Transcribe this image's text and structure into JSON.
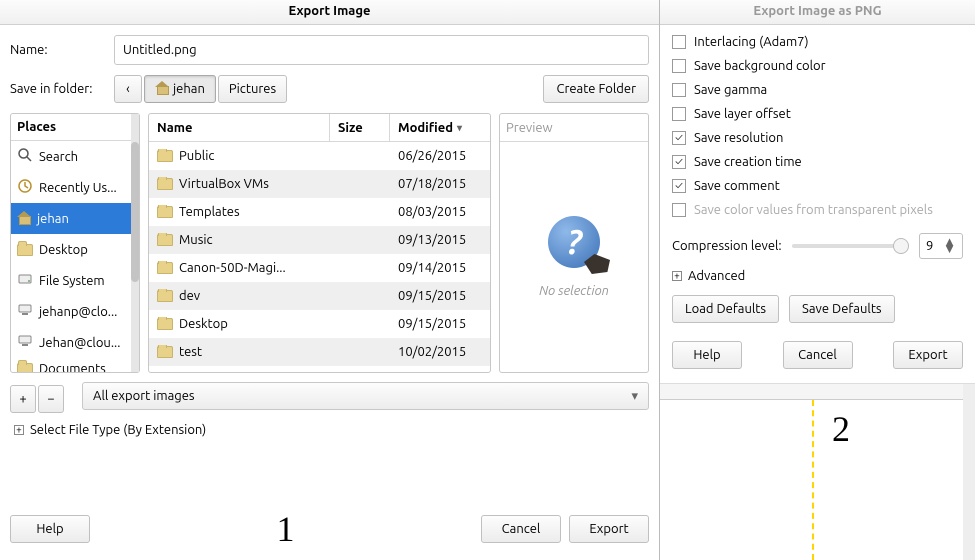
{
  "left": {
    "title": "Export Image",
    "name_label": "Name:",
    "name_value": "Untitled.png",
    "save_in_label": "Save in folder:",
    "breadcrumb": {
      "back": "‹",
      "seg1": "jehan",
      "seg2": "Pictures"
    },
    "create_folder": "Create Folder",
    "places_header": "Places",
    "places": [
      {
        "label": "Search",
        "icon": "search"
      },
      {
        "label": "Recently Us...",
        "icon": "recent"
      },
      {
        "label": "jehan",
        "icon": "home",
        "selected": true
      },
      {
        "label": "Desktop",
        "icon": "folder"
      },
      {
        "label": "File System",
        "icon": "disk"
      },
      {
        "label": "jehanp@clo...",
        "icon": "net"
      },
      {
        "label": "Jehan@clou...",
        "icon": "net"
      },
      {
        "label": "Documents",
        "icon": "folder",
        "cut": true
      }
    ],
    "files_header": {
      "name": "Name",
      "size": "Size",
      "modified": "Modified"
    },
    "files": [
      {
        "name": "Public",
        "modified": "06/26/2015"
      },
      {
        "name": "VirtualBox VMs",
        "modified": "07/18/2015"
      },
      {
        "name": "Templates",
        "modified": "08/03/2015"
      },
      {
        "name": "Music",
        "modified": "09/13/2015"
      },
      {
        "name": "Canon-50D-Magi...",
        "modified": "09/14/2015"
      },
      {
        "name": "dev",
        "modified": "09/15/2015"
      },
      {
        "name": "Desktop",
        "modified": "09/15/2015"
      },
      {
        "name": "test",
        "modified": "10/02/2015"
      }
    ],
    "preview_label": "Preview",
    "no_selection": "No selection",
    "add_btn": "+",
    "remove_btn": "−",
    "filter": "All export images",
    "filetype_expander": "Select File Type (By Extension)",
    "help": "Help",
    "cancel": "Cancel",
    "export": "Export",
    "big_num": "1"
  },
  "right": {
    "title": "Export Image as PNG",
    "options": [
      {
        "label": "Interlacing (Adam7)",
        "checked": false
      },
      {
        "label": "Save background color",
        "checked": false
      },
      {
        "label": "Save gamma",
        "checked": false
      },
      {
        "label": "Save layer offset",
        "checked": false
      },
      {
        "label": "Save resolution",
        "checked": true
      },
      {
        "label": "Save creation time",
        "checked": true
      },
      {
        "label": "Save comment",
        "checked": true
      },
      {
        "label": "Save color values from transparent pixels",
        "checked": false,
        "disabled": true
      }
    ],
    "compression_label": "Compression level:",
    "compression_value": "9",
    "advanced": "Advanced",
    "load_defaults": "Load Defaults",
    "save_defaults": "Save Defaults",
    "help": "Help",
    "cancel": "Cancel",
    "export": "Export",
    "big_num": "2"
  }
}
